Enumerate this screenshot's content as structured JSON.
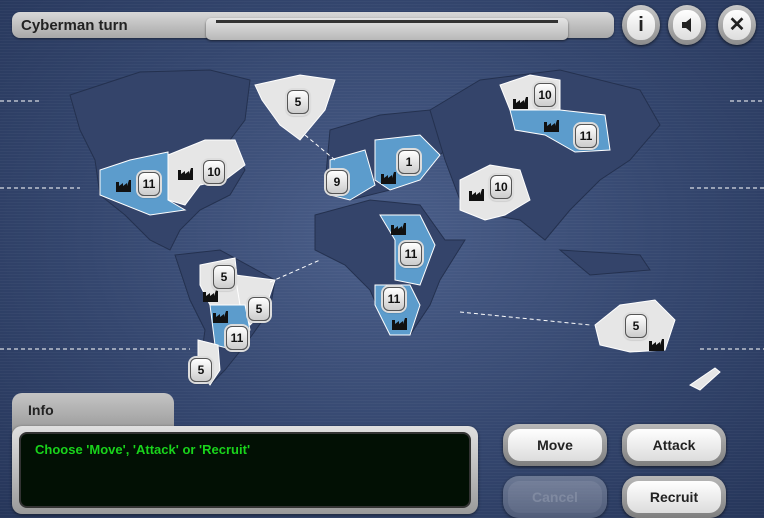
{
  "header": {
    "title": "Cyberman turn",
    "progress": 0,
    "buttons": {
      "info": "i",
      "sound": "sound-icon",
      "close": "✕"
    }
  },
  "colors": {
    "player": "#5c9ccc",
    "neutral": "#e6e6e6",
    "text_green": "#19d41b"
  },
  "territories": [
    {
      "name": "greenland",
      "units": "5",
      "owner": "neutral",
      "factory": false
    },
    {
      "name": "usa-east",
      "units": "10",
      "owner": "neutral",
      "factory": true
    },
    {
      "name": "usa-west",
      "units": "11",
      "owner": "player",
      "factory": true
    },
    {
      "name": "western-europe",
      "units": "9",
      "owner": "player",
      "factory": false
    },
    {
      "name": "eastern-europe",
      "units": "1",
      "owner": "player",
      "factory": true
    },
    {
      "name": "northern-russia",
      "units": "10",
      "owner": "neutral",
      "factory": true
    },
    {
      "name": "russia",
      "units": "11",
      "owner": "player",
      "factory": true
    },
    {
      "name": "middle-east",
      "units": "10",
      "owner": "neutral",
      "factory": true
    },
    {
      "name": "east-africa",
      "units": "11",
      "owner": "player",
      "factory": true
    },
    {
      "name": "southern-africa",
      "units": "11",
      "owner": "player",
      "factory": true
    },
    {
      "name": "northern-south-america",
      "units": "5",
      "owner": "neutral",
      "factory": true
    },
    {
      "name": "brazil",
      "units": "5",
      "owner": "neutral",
      "factory": false
    },
    {
      "name": "argentina",
      "units": "11",
      "owner": "player",
      "factory": true
    },
    {
      "name": "patagonia",
      "units": "5",
      "owner": "neutral",
      "factory": false
    },
    {
      "name": "australia",
      "units": "5",
      "owner": "neutral",
      "factory": true
    }
  ],
  "info": {
    "tab": "Info",
    "message": "Choose 'Move', 'Attack' or 'Recruit'"
  },
  "actions": {
    "move": "Move",
    "attack": "Attack",
    "cancel": "Cancel",
    "recruit": "Recruit"
  }
}
